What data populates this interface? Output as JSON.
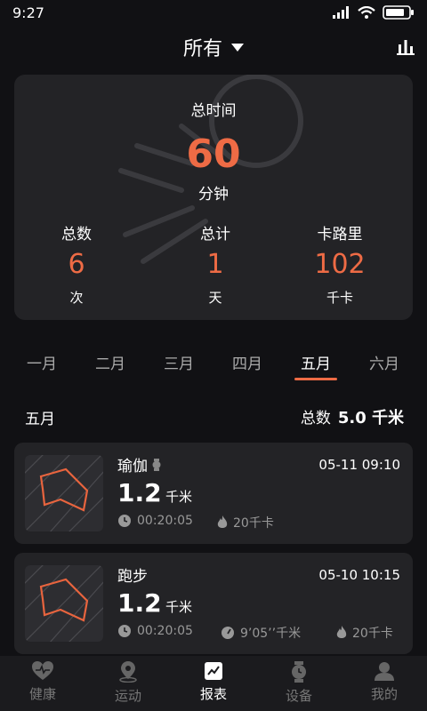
{
  "status": {
    "time": "9:27"
  },
  "header": {
    "title": "所有"
  },
  "summary": {
    "total_time_label": "总时间",
    "total_time_value": "60",
    "total_time_unit": "分钟",
    "stats": [
      {
        "label": "总数",
        "value": "6",
        "unit": "次"
      },
      {
        "label": "总计",
        "value": "1",
        "unit": "天"
      },
      {
        "label": "卡路里",
        "value": "102",
        "unit": "千卡"
      }
    ]
  },
  "months": [
    "一月",
    "二月",
    "三月",
    "四月",
    "五月",
    "六月"
  ],
  "active_month_index": 4,
  "section": {
    "title": "五月",
    "total_label": "总数",
    "total_value": "5.0 千米"
  },
  "activities": [
    {
      "name": "瑜伽",
      "date": "05-11  09:10",
      "distance": "1.2",
      "distance_unit": "千米",
      "duration": "00:20:05",
      "calories": "20千卡"
    },
    {
      "name": "跑步",
      "date": "05-10  10:15",
      "distance": "1.2",
      "distance_unit": "千米",
      "duration": "00:20:05",
      "pace": "9’05’’千米",
      "calories": "20千卡"
    }
  ],
  "tabs": [
    {
      "label": "健康",
      "icon": "heart-icon"
    },
    {
      "label": "运动",
      "icon": "location-pin-icon"
    },
    {
      "label": "报表",
      "icon": "chart-icon"
    },
    {
      "label": "设备",
      "icon": "watch-icon"
    },
    {
      "label": "我的",
      "icon": "person-icon"
    }
  ],
  "active_tab_index": 2,
  "colors": {
    "accent": "#ee6b45",
    "background": "#111114",
    "card": "#232326"
  }
}
